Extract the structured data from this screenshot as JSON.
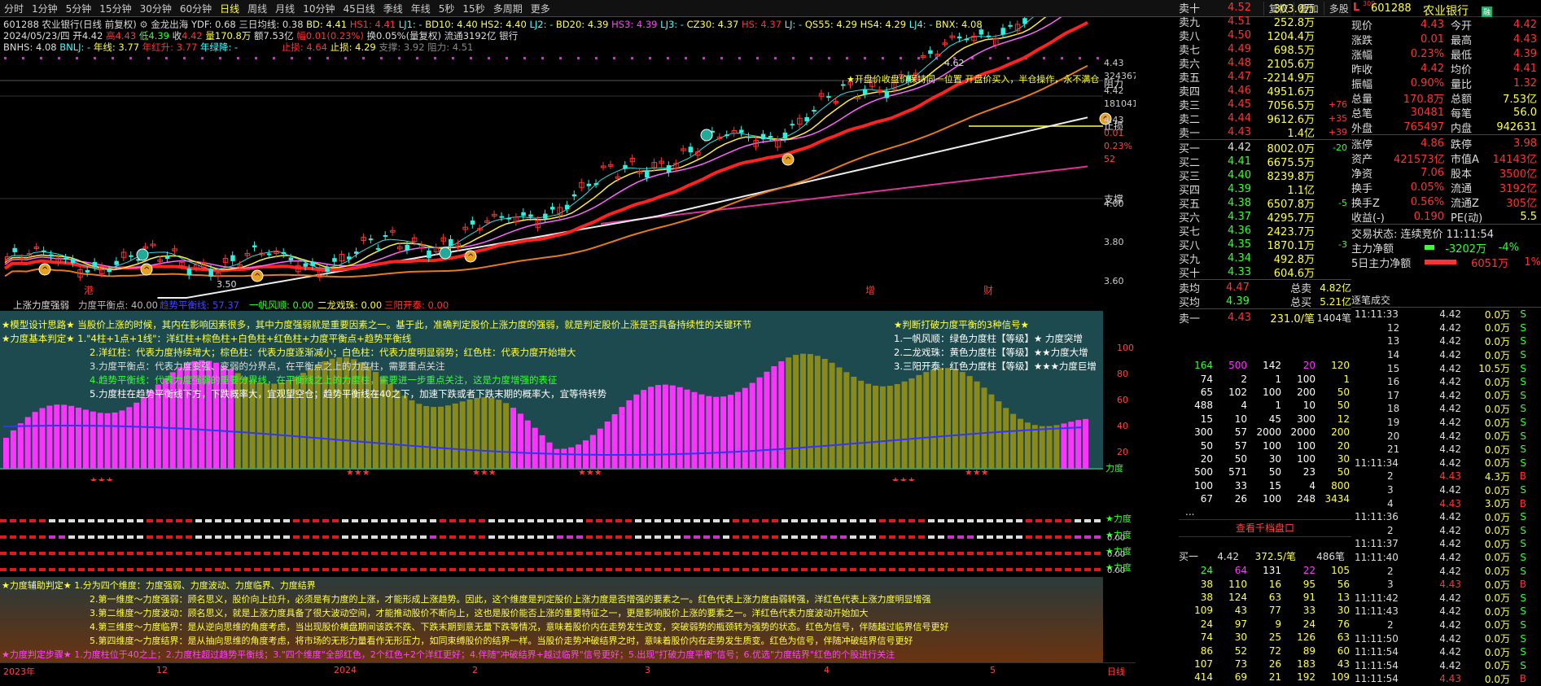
{
  "toolbar": {
    "left": [
      "分时",
      "1分钟",
      "5分钟",
      "15分钟",
      "30分钟",
      "60分钟",
      "日线",
      "周线",
      "月线",
      "10分钟",
      "45日线",
      "季线",
      "年线",
      "5秒",
      "15秒",
      "多周期",
      "更多"
    ],
    "active": "日线",
    "right": [
      "复权",
      "叠加",
      "多股",
      "统计",
      "画线",
      "F10",
      "标记",
      "+自选",
      "返回"
    ]
  },
  "stock": {
    "code": "601288",
    "name": "农业银行",
    "title": "601288 农业银行(日线 前复权)",
    "date": "2024/05/23/四",
    "open": "4.42",
    "high": "4.43",
    "low": "4.39",
    "close": "4.42",
    "volume": "170.8万",
    "amount": "7.53亿",
    "change": "0.01(0.23%)",
    "turnover": "换0.05%(量复权)",
    "float": "流通3192亿",
    "sector": "银行"
  },
  "indicators": {
    "l1": "金龙出海 YDF: 0.68",
    "l1b": "三日均线: 0.38",
    "l1c": "BD: 4.41",
    "l1d": "HS1: 4.41",
    "l1e": "LJ1: -",
    "l1f": "BD10: 4.40",
    "l1g": "HS2: 4.40",
    "l1h": "LJ2: -",
    "l1i": "BD20: 4.39",
    "l1j": "HS3: 4.39",
    "l1k": "LJ3: -",
    "l1l": "CZ30: 4.37",
    "l1m": "HS: 4.37",
    "l1n": "LJ: -",
    "l1o": "QS55: 4.29",
    "l1p": "HS4: 4.29",
    "l1q": "LJ4: -",
    "l1r": "BNX: 4.08",
    "l2": "BNHS: 4.08",
    "l2b": "BNLJ: -",
    "l2c": "年线: 3.77",
    "l2d": "年红升: 3.77",
    "l2e": "年绿降: -",
    "l2f": "止损: 4.64",
    "l2g": "止损: 4.29",
    "l2h": "支撑: 3.92",
    "l2i": "阻力: 4.51"
  },
  "annotations": {
    "open_hint": "★开盘价收盘价保持同一位置 开盘价买入，半仓操作，永不满仓",
    "resist": "阻力",
    "stop": "止损",
    "support": "支撑",
    "peak": "4.62",
    "low": "3.50"
  },
  "yaxis": [
    "4.43",
    "324367",
    "4.42",
    "181041",
    "4.43",
    "0.01",
    "0.23%",
    "52",
    "4.00",
    "3.80",
    "3.60"
  ],
  "xaxis": [
    "2023年",
    "12",
    "2024",
    "1",
    "2",
    "3",
    "4",
    "5",
    "日线"
  ],
  "events": [
    "港",
    "增",
    "财"
  ],
  "sub1": {
    "title": "上涨力度强弱",
    "items": [
      "力度平衡点: 40.00",
      "趋势平衡线: 57.37",
      "一帆风顺: 0.00",
      "二龙戏珠: 0.00",
      "三阳开泰: 0.00"
    ],
    "text": [
      "★模型设计思路★ 当股价上涨的时候，其内在影响因素很多，其中力度强弱就是重要因素之一。基于此，准确判定股价上涨力度的强弱，就是判定股价上涨是否具备持续性的关键环节",
      "★力度基本判定★ 1.\"4柱+1点+1线\"：洋红柱+棕色柱+白色柱+红色柱+力度平衡点+趋势平衡线",
      "2.洋红柱：代表力度持续增大；棕色柱：代表力度逐渐减小；白色柱：代表力度明显弱势；红色柱：代表力度开始增大",
      "3.力度平衡点：代表力度变强、变弱的分界点，在平衡点之上的力度柱，需要重点关注",
      "4.趋势平衡线：代表力度强弱的重要分界线，在平衡线之上的力度柱，需要进一步重点关注，这是力度增强的表征",
      "5.力度柱在趋势平衡线下方，下跌概率大，宜观望空仓；趋势平衡线在40之下，加速下跌或者下跌末期的概率大，宜等待转势"
    ],
    "right": [
      "★判断打破力度平衡的3种信号★",
      "1.一帆风顺：绿色力度柱【等级】★ 力度突增",
      "2.二龙戏珠：黄色力度柱【等级】★★力度大增",
      "3.三阳开泰：红色力度柱【等级】★★★力度巨增"
    ],
    "axis": [
      "100",
      "80",
      "60",
      "40",
      "20"
    ],
    "tag": "力度"
  },
  "sub2": {
    "tags": [
      "力度",
      "力度",
      "力度",
      "力度"
    ],
    "axis": [
      "0.00",
      "0.00",
      "0.00"
    ]
  },
  "sub3": {
    "text": [
      "★力度辅助判定★ 1.分为四个维度：力度强弱、力度波动、力度临界、力度结界",
      "2.第一维度～力度强弱：顾名思义，股价向上拉升，必须是有力度的上涨，才能形成上涨趋势。因此，这个维度是判定股价上涨力度是否增强的要素之一。红色代表上涨力度由弱转强，洋红色代表上涨力度明显增强",
      "3.第二维度～力度波动：顾名思义，就是上涨力度具备了很大波动空间，才能推动股价不断向上，这也是股价能否上涨的重要特征之一，更是影响股价上涨的要素之一。洋红色代表力度波动开始加大",
      "4.第三维度～力度临界：是从逆向思维的角度考虑，当出现股价横盘期间该跌不跌、下跌末期到意无量下跌等情况，意味着股价内在走势发生改变，突破弱势的瓶颈转为强势的状态。红色为信号，伴随越过临界信号更好",
      "5.第四维度～力度结界：是从抽向思维的角度考虑，将市场的无形力量看作无形压力，如同束缚股价的结界一样。当股价走势冲破结界之时，意味着股价内在走势发生质变。红色为信号，伴随冲破结界信号更好",
      "★力度判定步骤★ 1.力度柱位于40之上；2.力度柱超过趋势平衡线；3.\"四个维度\"全部红色，2个红色+2个洋红更好；4.伴随\"冲破结界+越过临界\"信号更好；5.出现\"打破力度平衡\"信号；6.优选\"力度结界\"红色的个股进行关注"
    ]
  },
  "orderbook": {
    "sell": [
      [
        "卖十",
        "4.52",
        "303.0万",
        ""
      ],
      [
        "卖九",
        "4.51",
        "252.8万",
        ""
      ],
      [
        "卖八",
        "4.50",
        "1204.4万",
        ""
      ],
      [
        "卖七",
        "4.49",
        "698.5万",
        ""
      ],
      [
        "卖六",
        "4.48",
        "2105.6万",
        ""
      ],
      [
        "卖五",
        "4.47",
        "-2214.9万",
        ""
      ],
      [
        "卖四",
        "4.46",
        "4951.6万",
        ""
      ],
      [
        "卖三",
        "4.45",
        "7056.5万",
        "+76"
      ],
      [
        "卖二",
        "4.44",
        "9612.6万",
        "+35"
      ],
      [
        "卖一",
        "4.43",
        "1.4亿",
        "+39"
      ]
    ],
    "buy": [
      [
        "买一",
        "4.42",
        "8002.0万",
        "-20"
      ],
      [
        "买二",
        "4.41",
        "6675.5万",
        ""
      ],
      [
        "买三",
        "4.40",
        "8239.8万",
        ""
      ],
      [
        "买四",
        "4.39",
        "1.1亿",
        ""
      ],
      [
        "买五",
        "4.38",
        "6507.8万",
        "-5"
      ],
      [
        "买六",
        "4.37",
        "4295.7万",
        ""
      ],
      [
        "买七",
        "4.36",
        "2423.7万",
        ""
      ],
      [
        "买八",
        "4.35",
        "1870.1万",
        "-3"
      ],
      [
        "买九",
        "4.34",
        "492.8万",
        ""
      ],
      [
        "买十",
        "4.33",
        "604.6万",
        ""
      ]
    ],
    "avg": [
      [
        "卖均",
        "4.47",
        "总卖",
        "4.82亿"
      ],
      [
        "买均",
        "4.39",
        "总买",
        "5.21亿"
      ]
    ],
    "sell1": {
      "label": "卖一",
      "price": "4.43",
      "vol": "231.0/笔",
      "count": "1404笔"
    },
    "buy1": {
      "label": "买一",
      "price": "4.42",
      "vol": "372.5/笔",
      "count": "486笔"
    },
    "queue_link": "查看千档盘口"
  },
  "queue_sell": [
    [
      "164",
      "500",
      "142",
      "20",
      "120"
    ],
    [
      "74",
      "2",
      "1",
      "100",
      "1"
    ],
    [
      "65",
      "102",
      "100",
      "200",
      "50"
    ],
    [
      "488",
      "4",
      "1",
      "10",
      "50"
    ],
    [
      "15",
      "10",
      "45",
      "300",
      "12"
    ],
    [
      "300",
      "57",
      "2000",
      "2000",
      "200"
    ],
    [
      "50",
      "57",
      "100",
      "100",
      "20"
    ],
    [
      "20",
      "50",
      "30",
      "100",
      "30"
    ],
    [
      "500",
      "571",
      "50",
      "23",
      "50"
    ],
    [
      "100",
      "33",
      "15",
      "4",
      "800"
    ],
    [
      "67",
      "26",
      "100",
      "248",
      "3434"
    ]
  ],
  "queue_buy": [
    [
      "24",
      "64",
      "131",
      "22",
      "105"
    ],
    [
      "38",
      "110",
      "16",
      "95",
      "56"
    ],
    [
      "38",
      "124",
      "63",
      "91",
      "13"
    ],
    [
      "109",
      "43",
      "77",
      "33",
      "30"
    ],
    [
      "24",
      "97",
      "9",
      "24",
      "76"
    ],
    [
      "74",
      "30",
      "25",
      "126",
      "63"
    ],
    [
      "86",
      "52",
      "72",
      "89",
      "60"
    ],
    [
      "107",
      "73",
      "26",
      "183",
      "43"
    ],
    [
      "414",
      "69",
      "21",
      "192",
      "109"
    ]
  ],
  "info": {
    "header_code": "601288",
    "header_name": "农业银行",
    "badge": "融",
    "rows": [
      [
        "现价",
        "4.43",
        "今开",
        "4.42"
      ],
      [
        "涨跌",
        "0.01",
        "最高",
        "4.43"
      ],
      [
        "涨幅",
        "0.23%",
        "最低",
        "4.39"
      ],
      [
        "昨收",
        "4.42",
        "均价",
        "4.41"
      ],
      [
        "振幅",
        "0.90%",
        "量比",
        "1.32"
      ],
      [
        "总量",
        "170.8万",
        "总额",
        "7.53亿"
      ],
      [
        "总笔",
        "30481",
        "每笔",
        "56.0"
      ],
      [
        "外盘",
        "765497",
        "内盘",
        "942631"
      ]
    ],
    "rows2": [
      [
        "涨停",
        "4.86",
        "跌停",
        "3.98"
      ],
      [
        "资产",
        "421573亿",
        "市值A",
        "14143亿"
      ],
      [
        "净资",
        "7.06",
        "股本",
        "3500亿"
      ],
      [
        "换手",
        "0.05%",
        "流通",
        "3192亿"
      ],
      [
        "换手Z",
        "0.56%",
        "流通Z",
        "305亿"
      ],
      [
        "收益(-)",
        "0.190",
        "PE(动)",
        "5.5"
      ]
    ],
    "status": "交易状态: 连续竞价 11:11:54",
    "flow1": [
      "主力净额",
      "-3202万",
      "-4%"
    ],
    "flow2": [
      "5日主力净额",
      "6051万",
      "1%"
    ]
  },
  "ticks": {
    "title": "逐笔成交",
    "rows": [
      [
        "11:11:33",
        "4.42",
        "0.0万",
        "S"
      ],
      [
        "12",
        "4.42",
        "0.0万",
        "S"
      ],
      [
        "13",
        "4.42",
        "0.0万",
        "S"
      ],
      [
        "14",
        "4.42",
        "0.0万",
        "S"
      ],
      [
        "15",
        "4.42",
        "10.5万",
        "S"
      ],
      [
        "16",
        "4.42",
        "0.0万",
        "S"
      ],
      [
        "17",
        "4.42",
        "0.0万",
        "S"
      ],
      [
        "18",
        "4.42",
        "0.0万",
        "S"
      ],
      [
        "19",
        "4.42",
        "0.0万",
        "S"
      ],
      [
        "20",
        "4.42",
        "0.0万",
        "S"
      ],
      [
        "21",
        "4.42",
        "0.0万",
        "S"
      ],
      [
        "11:11:34",
        "4.42",
        "0.0万",
        "S"
      ],
      [
        "2",
        "4.43",
        "4.3万",
        "B"
      ],
      [
        "3",
        "4.42",
        "0.0万",
        "S"
      ],
      [
        "4",
        "4.43",
        "3.0万",
        "B"
      ],
      [
        "11:11:36",
        "4.42",
        "0.0万",
        "S"
      ],
      [
        "2",
        "4.42",
        "0.0万",
        "S"
      ],
      [
        "11:11:37",
        "4.42",
        "0.0万",
        "S"
      ],
      [
        "11:11:40",
        "4.42",
        "0.0万",
        "S"
      ],
      [
        "2",
        "4.42",
        "0.0万",
        "S"
      ],
      [
        "3",
        "4.43",
        "0.0万",
        "B"
      ],
      [
        "11:11:42",
        "4.42",
        "0.0万",
        "S"
      ],
      [
        "11:11:43",
        "4.42",
        "0.0万",
        "S"
      ],
      [
        "2",
        "4.42",
        "0.0万",
        "S"
      ],
      [
        "11:11:50",
        "4.42",
        "0.0万",
        "S"
      ],
      [
        "11:11:54",
        "4.42",
        "0.0万",
        "S"
      ],
      [
        "11:11:54",
        "4.42",
        "0.0万",
        "S"
      ],
      [
        "11:11:54",
        "4.43",
        "0.0万",
        "B"
      ]
    ]
  },
  "colors": {
    "up": "#ff3333",
    "down": "#33ff33",
    "magenta": "#ff33ff",
    "olive": "#8a8a1a",
    "panel_bg": "#1d4a4e"
  }
}
